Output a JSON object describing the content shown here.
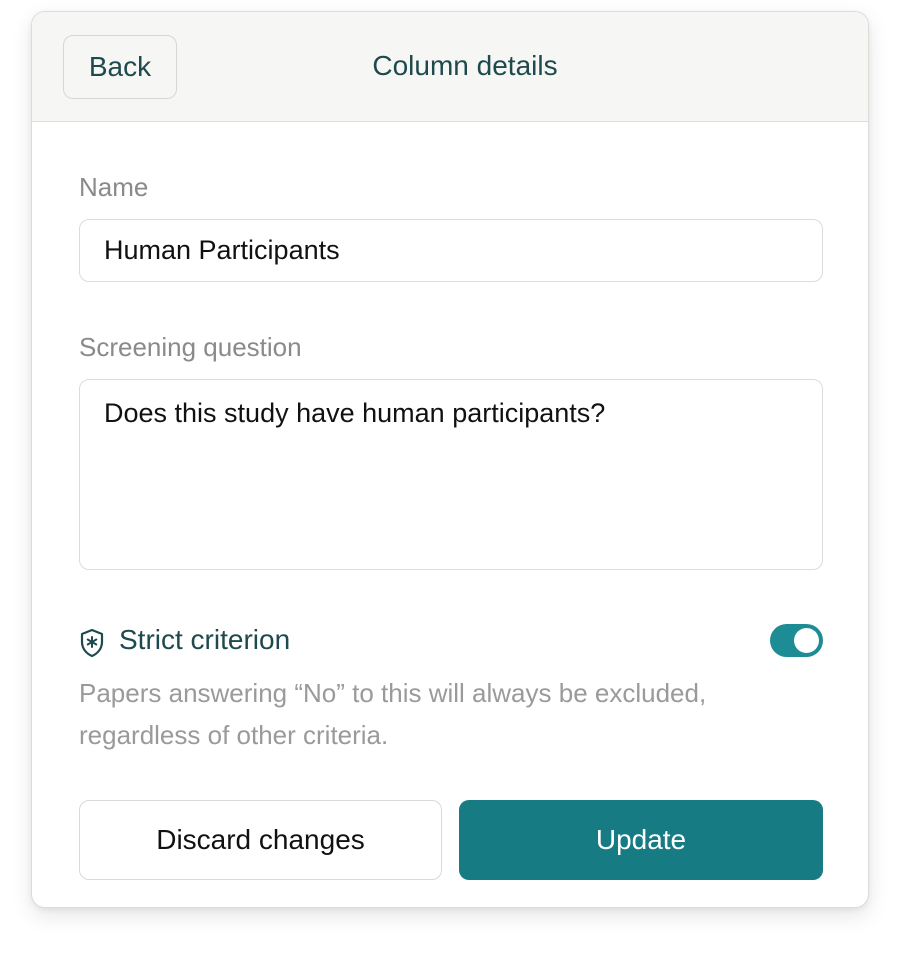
{
  "header": {
    "back_label": "Back",
    "title": "Column details"
  },
  "name_field": {
    "label": "Name",
    "value": "Human Participants"
  },
  "question_field": {
    "label": "Screening question",
    "value": "Does this study have human participants?"
  },
  "strict": {
    "icon": "shield-star-icon",
    "label": "Strict criterion",
    "enabled": true,
    "description": "Papers answering “No” to this will always be excluded, regardless of other criteria."
  },
  "actions": {
    "discard_label": "Discard changes",
    "update_label": "Update"
  },
  "colors": {
    "accent": "#167b83",
    "toggle_on": "#1d8c95",
    "heading_text": "#1e4a4d"
  }
}
